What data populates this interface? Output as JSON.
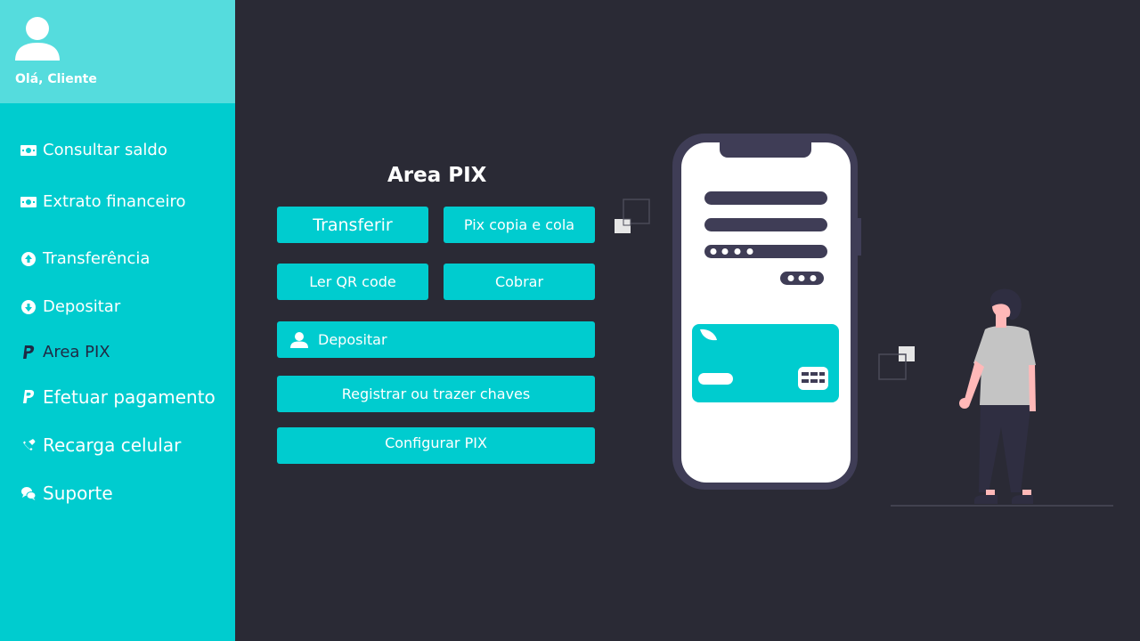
{
  "sidebar": {
    "greeting": "Olá, Cliente",
    "items": [
      {
        "label": "Consultar saldo",
        "icon": "money-bill-icon"
      },
      {
        "label": "Extrato financeiro",
        "icon": "money-bill-icon"
      },
      {
        "label": "Transferência",
        "icon": "arrow-circle-up-icon"
      },
      {
        "label": "Depositar",
        "icon": "arrow-circle-down-icon"
      },
      {
        "label": "Area PIX",
        "icon": "paypal-icon",
        "active": true
      },
      {
        "label": "Efetuar pagamento",
        "icon": "paypal-icon"
      },
      {
        "label": "Recarga celular",
        "icon": "phone-icon"
      },
      {
        "label": "Suporte",
        "icon": "chat-bubbles-icon"
      }
    ]
  },
  "main": {
    "title": "Area PIX",
    "buttons": {
      "transferir": "Transferir",
      "pix_copia_cola": "Pix copia e cola",
      "ler_qr_code": "Ler QR code",
      "cobrar": "Cobrar",
      "depositar": "Depositar",
      "registrar_chaves": "Registrar ou trazer chaves",
      "configurar_pix": "Configurar PIX"
    }
  },
  "colors": {
    "background": "#2a2a35",
    "sidebar": "#00cccf",
    "sidebar_header": "#55dcdd",
    "accent": "#00cccf",
    "active_text": "#1f2a44"
  }
}
